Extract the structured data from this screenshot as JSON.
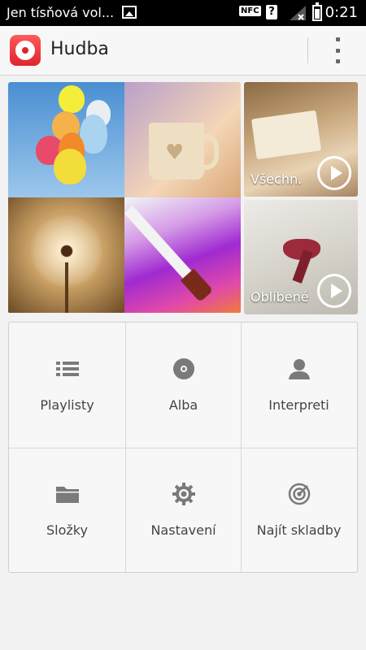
{
  "status_bar": {
    "notification_text": "Jen tísňová vol...",
    "nfc_label": "NFC",
    "unknown_sim_label": "?",
    "time": "0:21"
  },
  "app_bar": {
    "title": "Hudba",
    "app_icon": "music-disc-icon",
    "overflow_icon": "overflow-menu-icon"
  },
  "featured": {
    "all_songs_label": "Všechn.",
    "favorites_label": "Oblíbené"
  },
  "categories": [
    {
      "label": "Playlisty",
      "icon": "list-icon"
    },
    {
      "label": "Alba",
      "icon": "disc-icon"
    },
    {
      "label": "Interpreti",
      "icon": "person-icon"
    },
    {
      "label": "Složky",
      "icon": "folder-icon"
    },
    {
      "label": "Nastavení",
      "icon": "gear-icon"
    },
    {
      "label": "Najít skladby",
      "icon": "target-icon"
    }
  ],
  "colors": {
    "accent": "#e0242f",
    "icon_gray": "#7a7a7a",
    "background": "#f2f2f2"
  }
}
